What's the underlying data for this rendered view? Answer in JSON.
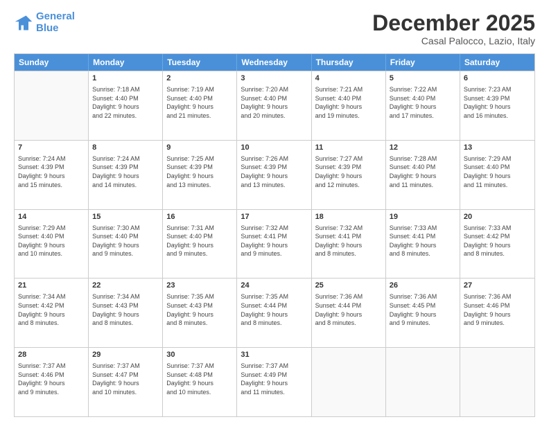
{
  "logo": {
    "line1": "General",
    "line2": "Blue"
  },
  "title": "December 2025",
  "location": "Casal Palocco, Lazio, Italy",
  "headers": [
    "Sunday",
    "Monday",
    "Tuesday",
    "Wednesday",
    "Thursday",
    "Friday",
    "Saturday"
  ],
  "rows": [
    [
      {
        "day": "",
        "info": ""
      },
      {
        "day": "1",
        "info": "Sunrise: 7:18 AM\nSunset: 4:40 PM\nDaylight: 9 hours\nand 22 minutes."
      },
      {
        "day": "2",
        "info": "Sunrise: 7:19 AM\nSunset: 4:40 PM\nDaylight: 9 hours\nand 21 minutes."
      },
      {
        "day": "3",
        "info": "Sunrise: 7:20 AM\nSunset: 4:40 PM\nDaylight: 9 hours\nand 20 minutes."
      },
      {
        "day": "4",
        "info": "Sunrise: 7:21 AM\nSunset: 4:40 PM\nDaylight: 9 hours\nand 19 minutes."
      },
      {
        "day": "5",
        "info": "Sunrise: 7:22 AM\nSunset: 4:40 PM\nDaylight: 9 hours\nand 17 minutes."
      },
      {
        "day": "6",
        "info": "Sunrise: 7:23 AM\nSunset: 4:39 PM\nDaylight: 9 hours\nand 16 minutes."
      }
    ],
    [
      {
        "day": "7",
        "info": "Sunrise: 7:24 AM\nSunset: 4:39 PM\nDaylight: 9 hours\nand 15 minutes."
      },
      {
        "day": "8",
        "info": "Sunrise: 7:24 AM\nSunset: 4:39 PM\nDaylight: 9 hours\nand 14 minutes."
      },
      {
        "day": "9",
        "info": "Sunrise: 7:25 AM\nSunset: 4:39 PM\nDaylight: 9 hours\nand 13 minutes."
      },
      {
        "day": "10",
        "info": "Sunrise: 7:26 AM\nSunset: 4:39 PM\nDaylight: 9 hours\nand 13 minutes."
      },
      {
        "day": "11",
        "info": "Sunrise: 7:27 AM\nSunset: 4:39 PM\nDaylight: 9 hours\nand 12 minutes."
      },
      {
        "day": "12",
        "info": "Sunrise: 7:28 AM\nSunset: 4:40 PM\nDaylight: 9 hours\nand 11 minutes."
      },
      {
        "day": "13",
        "info": "Sunrise: 7:29 AM\nSunset: 4:40 PM\nDaylight: 9 hours\nand 11 minutes."
      }
    ],
    [
      {
        "day": "14",
        "info": "Sunrise: 7:29 AM\nSunset: 4:40 PM\nDaylight: 9 hours\nand 10 minutes."
      },
      {
        "day": "15",
        "info": "Sunrise: 7:30 AM\nSunset: 4:40 PM\nDaylight: 9 hours\nand 9 minutes."
      },
      {
        "day": "16",
        "info": "Sunrise: 7:31 AM\nSunset: 4:40 PM\nDaylight: 9 hours\nand 9 minutes."
      },
      {
        "day": "17",
        "info": "Sunrise: 7:32 AM\nSunset: 4:41 PM\nDaylight: 9 hours\nand 9 minutes."
      },
      {
        "day": "18",
        "info": "Sunrise: 7:32 AM\nSunset: 4:41 PM\nDaylight: 9 hours\nand 8 minutes."
      },
      {
        "day": "19",
        "info": "Sunrise: 7:33 AM\nSunset: 4:41 PM\nDaylight: 9 hours\nand 8 minutes."
      },
      {
        "day": "20",
        "info": "Sunrise: 7:33 AM\nSunset: 4:42 PM\nDaylight: 9 hours\nand 8 minutes."
      }
    ],
    [
      {
        "day": "21",
        "info": "Sunrise: 7:34 AM\nSunset: 4:42 PM\nDaylight: 9 hours\nand 8 minutes."
      },
      {
        "day": "22",
        "info": "Sunrise: 7:34 AM\nSunset: 4:43 PM\nDaylight: 9 hours\nand 8 minutes."
      },
      {
        "day": "23",
        "info": "Sunrise: 7:35 AM\nSunset: 4:43 PM\nDaylight: 9 hours\nand 8 minutes."
      },
      {
        "day": "24",
        "info": "Sunrise: 7:35 AM\nSunset: 4:44 PM\nDaylight: 9 hours\nand 8 minutes."
      },
      {
        "day": "25",
        "info": "Sunrise: 7:36 AM\nSunset: 4:44 PM\nDaylight: 9 hours\nand 8 minutes."
      },
      {
        "day": "26",
        "info": "Sunrise: 7:36 AM\nSunset: 4:45 PM\nDaylight: 9 hours\nand 9 minutes."
      },
      {
        "day": "27",
        "info": "Sunrise: 7:36 AM\nSunset: 4:46 PM\nDaylight: 9 hours\nand 9 minutes."
      }
    ],
    [
      {
        "day": "28",
        "info": "Sunrise: 7:37 AM\nSunset: 4:46 PM\nDaylight: 9 hours\nand 9 minutes."
      },
      {
        "day": "29",
        "info": "Sunrise: 7:37 AM\nSunset: 4:47 PM\nDaylight: 9 hours\nand 10 minutes."
      },
      {
        "day": "30",
        "info": "Sunrise: 7:37 AM\nSunset: 4:48 PM\nDaylight: 9 hours\nand 10 minutes."
      },
      {
        "day": "31",
        "info": "Sunrise: 7:37 AM\nSunset: 4:49 PM\nDaylight: 9 hours\nand 11 minutes."
      },
      {
        "day": "",
        "info": ""
      },
      {
        "day": "",
        "info": ""
      },
      {
        "day": "",
        "info": ""
      }
    ]
  ]
}
